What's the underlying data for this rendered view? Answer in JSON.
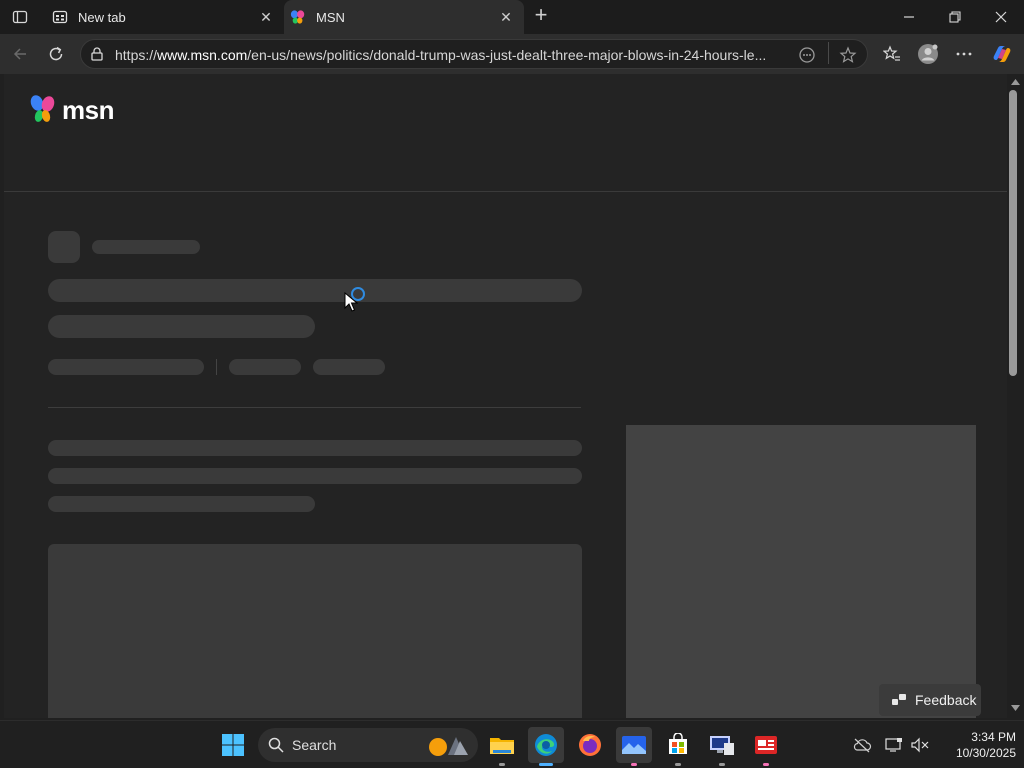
{
  "browser": {
    "tabs": [
      {
        "title": "New tab",
        "active": false
      },
      {
        "title": "MSN",
        "active": true
      }
    ],
    "url_prefix": "https://",
    "url_host": "www.msn.com",
    "url_path": "/en-us/news/politics/donald-trump-was-just-dealt-three-major-blows-in-24-hours-le..."
  },
  "page": {
    "logo_text": "msn",
    "feedback_label": "Feedback",
    "loading": true
  },
  "taskbar": {
    "search_placeholder": "Search",
    "apps": [
      "start",
      "search",
      "file-explorer",
      "edge",
      "firefox",
      "photos",
      "microsoft-store",
      "remote-desktop",
      "news"
    ]
  },
  "clock": {
    "time": "3:34 PM",
    "date": "10/30/2025"
  },
  "colors": {
    "background": "#202020",
    "skeleton": "#3a3a3a",
    "accent": "#2f8be0"
  }
}
